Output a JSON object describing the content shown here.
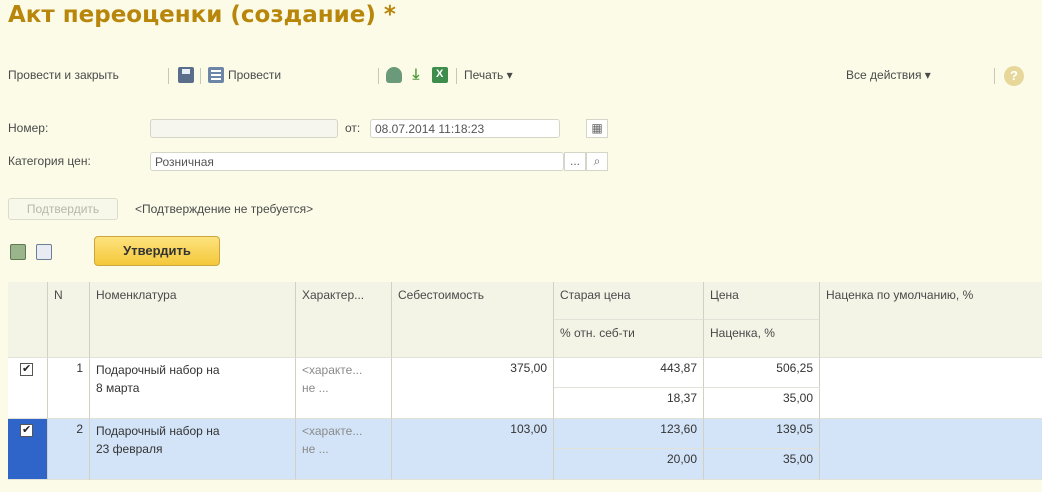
{
  "window": {
    "title": "Акт переоценки (создание) *"
  },
  "toolbar": {
    "post_close": "Провести и закрыть",
    "post": "Провести",
    "print": "Печать ▾",
    "all_actions": "Все действия ▾",
    "help": "?"
  },
  "form": {
    "number_label": "Номер:",
    "number_value": "",
    "date_label": "от:",
    "date_value": "08.07.2014 11:18:23",
    "price_category_label": "Категория цен:",
    "price_category_value": "Розничная",
    "select_button": "...",
    "confirm_button": "Подтвердить",
    "confirm_status": "<Подтверждение не требуется>",
    "approve_button": "Утвердить"
  },
  "table": {
    "headers": {
      "n": "N",
      "nomenclature": "Номенклатура",
      "characteristic": "Характер...",
      "cost": "Себестоимость",
      "old_price": "Старая цена",
      "old_price_sub": "% отн. себ-ти",
      "price": "Цена",
      "price_sub": "Наценка, %",
      "default_markup": "Наценка по умолчанию, %"
    },
    "rows": [
      {
        "checked": true,
        "n": "1",
        "name1": "Подарочный набор на",
        "name2": "8 марта",
        "char1": "<характе...",
        "char2": "не ...",
        "cost": "375,00",
        "old_price": "443,87",
        "old_pct": "18,37",
        "price": "506,25",
        "markup": "35,00"
      },
      {
        "checked": true,
        "n": "2",
        "name1": "Подарочный набор на",
        "name2": "23 февраля",
        "char1": "<характе...",
        "char2": "не ...",
        "cost": "103,00",
        "old_price": "123,60",
        "old_pct": "20,00",
        "price": "139,05",
        "markup": "35,00"
      }
    ]
  }
}
